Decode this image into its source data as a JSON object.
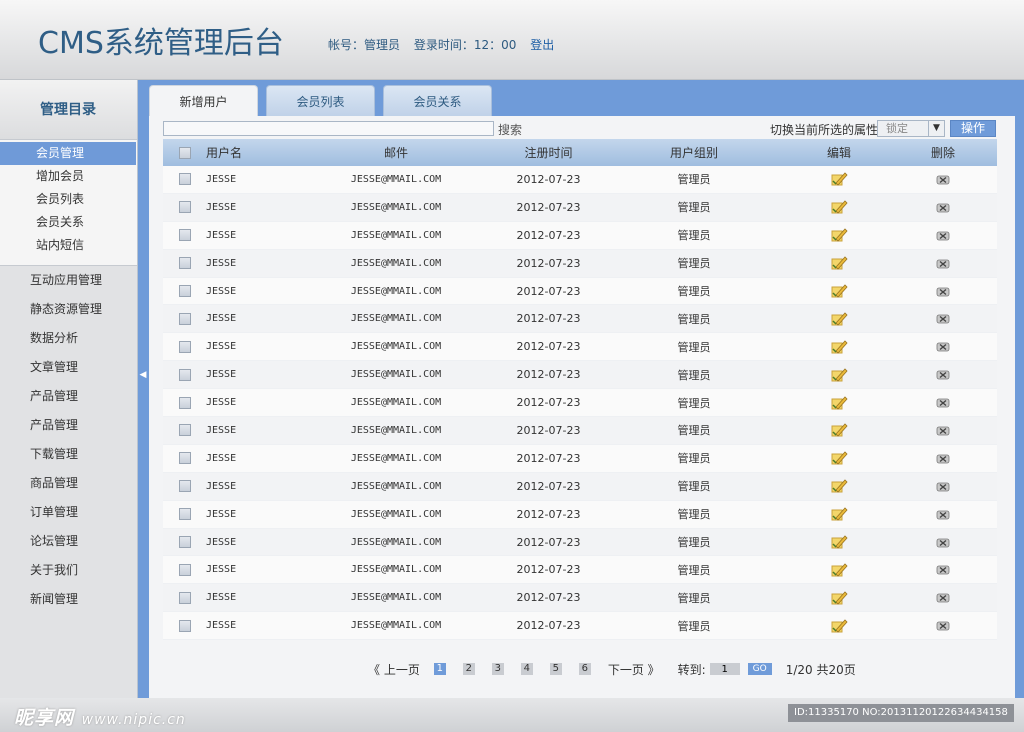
{
  "header": {
    "title": "CMS系统管理后台",
    "account": "帐号：管理员",
    "login_time": "登录时间：12：00",
    "logout": "登出"
  },
  "sidebar": {
    "title": "管理目录",
    "sub_items": [
      {
        "label": "会员管理",
        "active": true
      },
      {
        "label": "增加会员"
      },
      {
        "label": "会员列表"
      },
      {
        "label": "会员关系"
      },
      {
        "label": "站内短信"
      }
    ],
    "groups": [
      "互动应用管理",
      "静态资源管理",
      "数据分析",
      "文章管理",
      "产品管理",
      "产品管理",
      "下载管理",
      "商品管理",
      "订单管理",
      "论坛管理",
      "关于我们",
      "新闻管理"
    ]
  },
  "tabs": [
    {
      "label": "新增用户",
      "active": true
    },
    {
      "label": "会员列表"
    },
    {
      "label": "会员关系"
    }
  ],
  "toolbar": {
    "search_label": "搜索",
    "switch_label": "切换当前所选的属性",
    "select_value": "锁定",
    "op_button": "操作"
  },
  "table": {
    "headers": [
      "用户名",
      "邮件",
      "注册时间",
      "用户组别",
      "编辑",
      "删除"
    ],
    "rows": [
      {
        "name": "JESSE",
        "email": "JESSE@MMAIL.COM",
        "date": "2012-07-23",
        "group": "管理员"
      },
      {
        "name": "JESSE",
        "email": "JESSE@MMAIL.COM",
        "date": "2012-07-23",
        "group": "管理员"
      },
      {
        "name": "JESSE",
        "email": "JESSE@MMAIL.COM",
        "date": "2012-07-23",
        "group": "管理员"
      },
      {
        "name": "JESSE",
        "email": "JESSE@MMAIL.COM",
        "date": "2012-07-23",
        "group": "管理员"
      },
      {
        "name": "JESSE",
        "email": "JESSE@MMAIL.COM",
        "date": "2012-07-23",
        "group": "管理员"
      },
      {
        "name": "JESSE",
        "email": "JESSE@MMAIL.COM",
        "date": "2012-07-23",
        "group": "管理员"
      },
      {
        "name": "JESSE",
        "email": "JESSE@MMAIL.COM",
        "date": "2012-07-23",
        "group": "管理员"
      },
      {
        "name": "JESSE",
        "email": "JESSE@MMAIL.COM",
        "date": "2012-07-23",
        "group": "管理员"
      },
      {
        "name": "JESSE",
        "email": "JESSE@MMAIL.COM",
        "date": "2012-07-23",
        "group": "管理员"
      },
      {
        "name": "JESSE",
        "email": "JESSE@MMAIL.COM",
        "date": "2012-07-23",
        "group": "管理员"
      },
      {
        "name": "JESSE",
        "email": "JESSE@MMAIL.COM",
        "date": "2012-07-23",
        "group": "管理员"
      },
      {
        "name": "JESSE",
        "email": "JESSE@MMAIL.COM",
        "date": "2012-07-23",
        "group": "管理员"
      },
      {
        "name": "JESSE",
        "email": "JESSE@MMAIL.COM",
        "date": "2012-07-23",
        "group": "管理员"
      },
      {
        "name": "JESSE",
        "email": "JESSE@MMAIL.COM",
        "date": "2012-07-23",
        "group": "管理员"
      },
      {
        "name": "JESSE",
        "email": "JESSE@MMAIL.COM",
        "date": "2012-07-23",
        "group": "管理员"
      },
      {
        "name": "JESSE",
        "email": "JESSE@MMAIL.COM",
        "date": "2012-07-23",
        "group": "管理员"
      },
      {
        "name": "JESSE",
        "email": "JESSE@MMAIL.COM",
        "date": "2012-07-23",
        "group": "管理员"
      }
    ]
  },
  "pager": {
    "prev": "《 上一页",
    "pages": [
      "1",
      "2",
      "3",
      "4",
      "5",
      "6"
    ],
    "current": "1",
    "next": "下一页 》",
    "goto_label": "转到:",
    "goto_value": "1",
    "go": "GO",
    "summary": "1/20 共20页"
  },
  "watermark": {
    "left_logo": "昵享网",
    "left_url": "www.nipic.cn",
    "right_id": "ID:11335170 NO:20131120122634434158"
  },
  "colors": {
    "accent": "#6f9bd9",
    "title": "#2f5e86"
  }
}
